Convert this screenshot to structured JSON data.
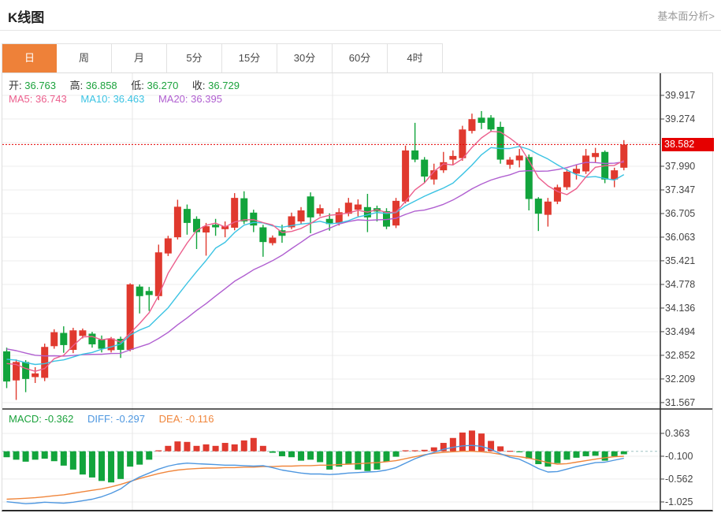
{
  "page": {
    "title": "K线图",
    "header_link": "基本面分析>"
  },
  "tabs": [
    {
      "label": "日",
      "active": true
    },
    {
      "label": "周",
      "active": false
    },
    {
      "label": "月",
      "active": false
    },
    {
      "label": "5分",
      "active": false
    },
    {
      "label": "15分",
      "active": false
    },
    {
      "label": "30分",
      "active": false
    },
    {
      "label": "60分",
      "active": false
    },
    {
      "label": "4时",
      "active": false
    }
  ],
  "ohlc_legend": {
    "open_label": "开:",
    "open": "36.763",
    "high_label": "高:",
    "high": "36.858",
    "low_label": "低:",
    "low": "36.270",
    "close_label": "收:",
    "close": "36.729"
  },
  "ma_legend": [
    {
      "label": "MA5:",
      "value": "36.743"
    },
    {
      "label": "MA10:",
      "value": "36.463"
    },
    {
      "label": "MA20:",
      "value": "36.395"
    }
  ],
  "macd_legend": [
    {
      "label": "MACD:",
      "value": "-0.362"
    },
    {
      "label": "DIFF:",
      "value": "-0.297"
    },
    {
      "label": "DEA:",
      "value": "-0.116"
    }
  ],
  "current_price_tag": "38.582",
  "colors": {
    "up_candle": "#e0392e",
    "down_candle": "#12a43c",
    "ma5": "#ec5f8d",
    "ma10": "#3bc3e3",
    "ma20": "#b05fd0",
    "diff_line": "#4e97e0",
    "dea_line": "#f0863c",
    "price_line": "#e50000",
    "price_tag_bg": "#e50000",
    "active_tab": "#ee8139",
    "grid": "#ededed",
    "vgrid": "#e7e7e7",
    "axis": "#2b2b2b",
    "zero_dash": "#9fc4c4"
  },
  "chart_data": {
    "type": "candlestick",
    "title": "K线图",
    "panes": [
      "price",
      "MACD"
    ],
    "x_axis_labels": [],
    "price_axis_ticks": [
      "39.917",
      "39.274",
      "37.990",
      "37.347",
      "36.705",
      "36.063",
      "35.421",
      "34.778",
      "34.136",
      "33.494",
      "32.852",
      "32.209",
      "31.567"
    ],
    "price_gridline_step": 0.6425,
    "current_price": 38.582,
    "macd_axis_ticks": [
      "0.363",
      "-0.100",
      "-0.562",
      "-1.025"
    ],
    "candles_ohlc": [
      [
        32.96,
        33.06,
        31.96,
        32.14
      ],
      [
        32.17,
        32.74,
        31.64,
        32.67
      ],
      [
        32.67,
        32.72,
        31.85,
        32.21
      ],
      [
        32.26,
        32.53,
        32.1,
        32.36
      ],
      [
        32.24,
        33.17,
        32.15,
        33.08
      ],
      [
        33.1,
        33.56,
        33.03,
        33.48
      ],
      [
        33.46,
        33.64,
        32.92,
        33.13
      ],
      [
        33.0,
        33.6,
        32.91,
        33.53
      ],
      [
        33.38,
        33.58,
        33.31,
        33.53
      ],
      [
        33.44,
        33.49,
        33.06,
        33.15
      ],
      [
        33.28,
        33.39,
        32.93,
        33.03
      ],
      [
        32.99,
        33.35,
        32.93,
        33.31
      ],
      [
        33.3,
        33.36,
        32.78,
        33.0
      ],
      [
        33.0,
        34.81,
        32.96,
        34.78
      ],
      [
        34.72,
        34.78,
        33.99,
        34.46
      ],
      [
        34.6,
        34.71,
        34.06,
        34.49
      ],
      [
        34.46,
        35.86,
        34.35,
        35.65
      ],
      [
        35.62,
        36.1,
        35.55,
        36.03
      ],
      [
        36.06,
        37.08,
        36.0,
        36.89
      ],
      [
        36.83,
        36.95,
        36.13,
        36.45
      ],
      [
        36.56,
        36.63,
        35.74,
        36.2
      ],
      [
        36.19,
        36.45,
        35.56,
        36.36
      ],
      [
        36.4,
        36.56,
        36.1,
        36.33
      ],
      [
        36.28,
        36.49,
        36.06,
        36.36
      ],
      [
        36.32,
        37.26,
        36.25,
        37.13
      ],
      [
        37.12,
        37.31,
        36.42,
        36.49
      ],
      [
        36.73,
        36.81,
        36.2,
        36.38
      ],
      [
        36.33,
        36.4,
        35.53,
        35.93
      ],
      [
        35.9,
        36.11,
        35.84,
        36.05
      ],
      [
        36.25,
        36.4,
        35.91,
        36.1
      ],
      [
        36.33,
        36.73,
        36.28,
        36.63
      ],
      [
        36.49,
        36.88,
        36.42,
        36.79
      ],
      [
        37.17,
        37.28,
        36.17,
        36.6
      ],
      [
        36.7,
        36.95,
        36.63,
        36.85
      ],
      [
        36.56,
        36.71,
        36.24,
        36.42
      ],
      [
        36.45,
        36.85,
        36.38,
        36.74
      ],
      [
        36.7,
        37.13,
        36.63,
        37.0
      ],
      [
        36.81,
        37.09,
        36.63,
        36.95
      ],
      [
        36.88,
        37.24,
        36.2,
        36.6
      ],
      [
        36.85,
        36.92,
        36.49,
        36.76
      ],
      [
        36.77,
        36.85,
        36.28,
        36.35
      ],
      [
        36.38,
        37.13,
        36.31,
        37.05
      ],
      [
        37.03,
        38.55,
        36.98,
        38.42
      ],
      [
        38.42,
        39.17,
        38.1,
        38.17
      ],
      [
        38.17,
        38.24,
        37.53,
        37.71
      ],
      [
        37.63,
        38.06,
        37.49,
        37.88
      ],
      [
        37.88,
        38.38,
        37.81,
        38.1
      ],
      [
        38.17,
        38.42,
        38.03,
        38.27
      ],
      [
        38.21,
        39.09,
        38.14,
        38.99
      ],
      [
        38.95,
        39.42,
        38.88,
        39.27
      ],
      [
        39.31,
        39.49,
        39.0,
        39.17
      ],
      [
        39.31,
        39.38,
        38.92,
        38.99
      ],
      [
        39.06,
        39.2,
        38.06,
        38.17
      ],
      [
        38.03,
        38.24,
        37.92,
        38.17
      ],
      [
        38.15,
        38.46,
        37.96,
        38.28
      ],
      [
        38.24,
        38.31,
        36.79,
        37.1
      ],
      [
        37.11,
        37.15,
        36.23,
        36.7
      ],
      [
        36.67,
        37.13,
        36.35,
        37.03
      ],
      [
        37.03,
        37.49,
        36.96,
        37.42
      ],
      [
        37.42,
        37.92,
        37.35,
        37.84
      ],
      [
        37.79,
        38.03,
        37.63,
        37.92
      ],
      [
        37.85,
        38.46,
        37.78,
        38.28
      ],
      [
        38.24,
        38.49,
        38.1,
        38.35
      ],
      [
        38.38,
        38.42,
        37.53,
        37.63
      ],
      [
        37.63,
        37.95,
        37.42,
        37.88
      ],
      [
        37.95,
        38.7,
        37.88,
        38.58
      ]
    ],
    "ma_seed_closes": [
      33.6,
      33.55,
      33.5,
      33.45,
      33.4,
      33.3,
      33.2,
      33.1,
      33.0,
      32.95,
      32.9,
      32.9,
      32.85,
      32.85,
      32.8,
      32.8,
      32.75,
      32.75,
      32.7
    ],
    "macd_hist": [
      -0.12,
      -0.17,
      -0.21,
      -0.17,
      -0.15,
      -0.2,
      -0.29,
      -0.37,
      -0.47,
      -0.53,
      -0.6,
      -0.63,
      -0.56,
      -0.31,
      -0.27,
      -0.17,
      0.02,
      0.11,
      0.2,
      0.19,
      0.11,
      0.14,
      0.11,
      0.17,
      0.14,
      0.22,
      0.27,
      0.11,
      -0.03,
      -0.1,
      -0.12,
      -0.19,
      -0.17,
      -0.22,
      -0.37,
      -0.31,
      -0.27,
      -0.37,
      -0.4,
      -0.37,
      -0.21,
      -0.11,
      0.02,
      0.02,
      0.03,
      0.08,
      0.17,
      0.27,
      0.38,
      0.42,
      0.36,
      0.21,
      0.1,
      0.01,
      -0.01,
      -0.15,
      -0.26,
      -0.31,
      -0.24,
      -0.17,
      -0.13,
      -0.1,
      -0.09,
      -0.19,
      -0.1,
      -0.06
    ],
    "diff": [
      -1.02,
      -1.04,
      -1.06,
      -1.05,
      -1.03,
      -1.04,
      -1.05,
      -1.03,
      -1.0,
      -0.97,
      -0.92,
      -0.85,
      -0.76,
      -0.62,
      -0.52,
      -0.44,
      -0.36,
      -0.3,
      -0.26,
      -0.24,
      -0.25,
      -0.26,
      -0.27,
      -0.28,
      -0.28,
      -0.29,
      -0.3,
      -0.29,
      -0.33,
      -0.38,
      -0.41,
      -0.44,
      -0.46,
      -0.46,
      -0.47,
      -0.46,
      -0.44,
      -0.43,
      -0.42,
      -0.41,
      -0.38,
      -0.33,
      -0.24,
      -0.15,
      -0.08,
      -0.02,
      0.04,
      0.08,
      0.11,
      0.12,
      0.1,
      0.04,
      -0.05,
      -0.12,
      -0.16,
      -0.25,
      -0.35,
      -0.42,
      -0.41,
      -0.36,
      -0.31,
      -0.27,
      -0.23,
      -0.22,
      -0.18,
      -0.14
    ],
    "dea": [
      -0.97,
      -0.96,
      -0.95,
      -0.94,
      -0.92,
      -0.9,
      -0.88,
      -0.85,
      -0.82,
      -0.79,
      -0.76,
      -0.72,
      -0.67,
      -0.61,
      -0.55,
      -0.5,
      -0.45,
      -0.41,
      -0.38,
      -0.36,
      -0.35,
      -0.34,
      -0.34,
      -0.33,
      -0.33,
      -0.32,
      -0.32,
      -0.31,
      -0.31,
      -0.3,
      -0.3,
      -0.29,
      -0.29,
      -0.28,
      -0.28,
      -0.27,
      -0.26,
      -0.25,
      -0.24,
      -0.23,
      -0.21,
      -0.19,
      -0.15,
      -0.11,
      -0.07,
      -0.04,
      -0.02,
      -0.01,
      0.0,
      0.0,
      -0.01,
      -0.03,
      -0.06,
      -0.09,
      -0.11,
      -0.14,
      -0.18,
      -0.23,
      -0.26,
      -0.25,
      -0.22,
      -0.19,
      -0.16,
      -0.13,
      -0.11,
      -0.1
    ]
  }
}
